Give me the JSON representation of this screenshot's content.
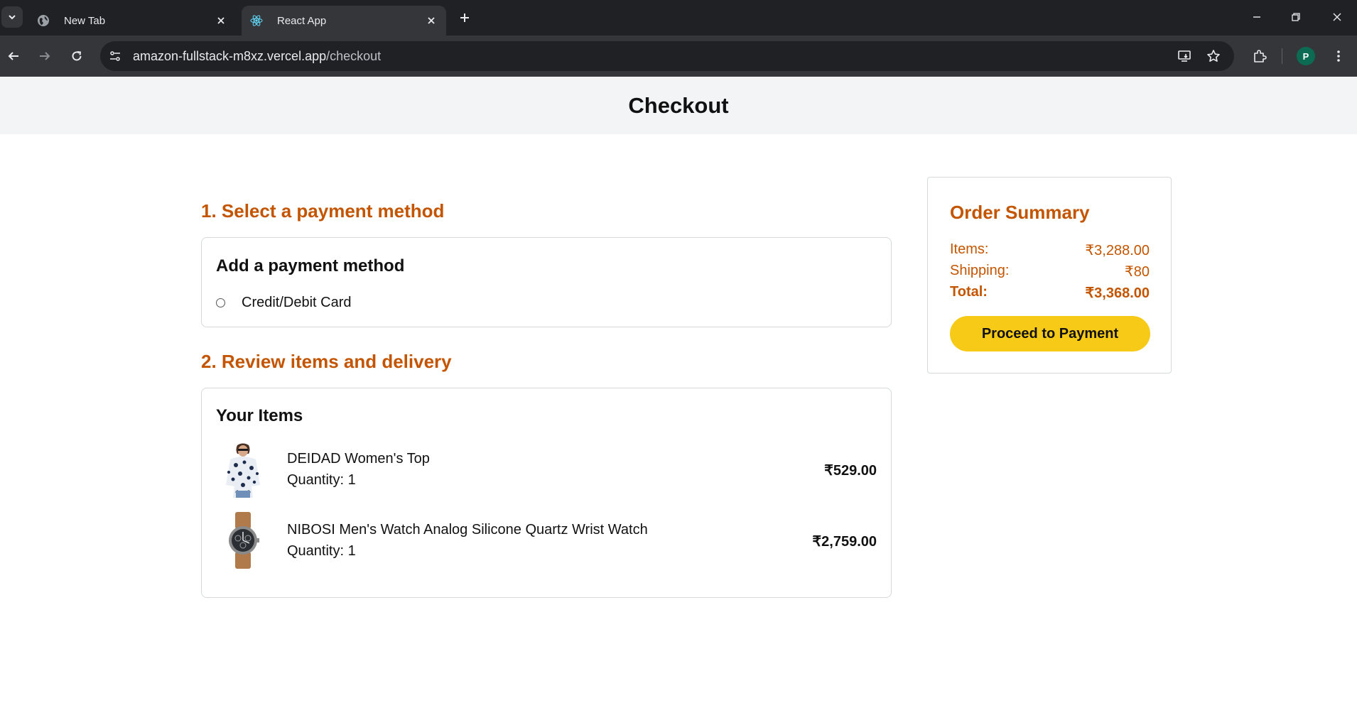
{
  "browser": {
    "tabs": [
      {
        "title": "New Tab",
        "favicon": "globe-icon",
        "active": false
      },
      {
        "title": "React App",
        "favicon": "react-icon",
        "active": true
      }
    ],
    "url_host": "amazon-fullstack-m8xz.vercel.app",
    "url_path": "/checkout",
    "profile_initial": "P",
    "colors": {
      "tabbar": "#202124",
      "toolbar": "#35363a",
      "profile": "#0b6b53"
    }
  },
  "page": {
    "title": "Checkout",
    "accent_color": "#c45500",
    "button_color": "#f7ca18"
  },
  "payment": {
    "section_title": "1. Select a payment method",
    "card_heading": "Add a payment method",
    "option_label": "Credit/Debit Card",
    "option_selected": false
  },
  "review": {
    "section_title": "2. Review items and delivery",
    "card_heading": "Your Items",
    "items": [
      {
        "name": "DEIDAD Women's Top",
        "quantity": "Quantity: 1",
        "price": "₹529.00",
        "image": "floral-top-image"
      },
      {
        "name": "NIBOSI Men's Watch Analog Silicone Quartz Wrist Watch",
        "quantity": "Quantity: 1",
        "price": "₹2,759.00",
        "image": "wrist-watch-image"
      }
    ]
  },
  "summary": {
    "title": "Order Summary",
    "items_label": "Items:",
    "items_value": "₹3,288.00",
    "shipping_label": "Shipping:",
    "shipping_value": "₹80",
    "total_label": "Total:",
    "total_value": "₹3,368.00",
    "button_label": "Proceed to Payment"
  }
}
